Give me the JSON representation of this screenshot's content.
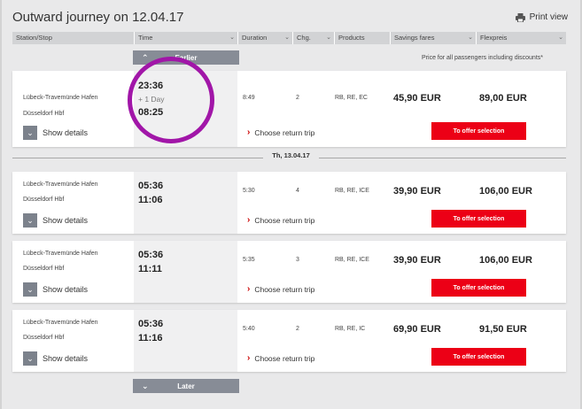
{
  "header": {
    "title": "Outward journey on 12.04.17",
    "print_label": "Print view"
  },
  "columns": [
    {
      "label": "Station/Stop"
    },
    {
      "label": "Time"
    },
    {
      "label": "Duration"
    },
    {
      "label": "Chg."
    },
    {
      "label": "Products"
    },
    {
      "label": "Savings fares"
    },
    {
      "label": "Flexpreis"
    }
  ],
  "earlier_label": "Earlier",
  "later_label": "Later",
  "price_note": "Price for all passengers including discounts*",
  "day_separator": "Th, 13.04.17",
  "connections": [
    {
      "from": "Lübeck-Travemünde Hafen",
      "to": "Düsseldorf Hbf",
      "dep": "23:36",
      "extra": "+ 1 Day",
      "arr": "08:25",
      "duration": "8:49",
      "changes": "2",
      "products": "RB, RE, EC",
      "savings": "45,90 EUR",
      "flex": "89,00 EUR",
      "details_label": "Show details",
      "return_label": "Choose return trip",
      "offer_label": "To offer selection"
    },
    {
      "from": "Lübeck-Travemünde Hafen",
      "to": "Düsseldorf Hbf",
      "dep": "05:36",
      "arr": "11:06",
      "duration": "5:30",
      "changes": "4",
      "products": "RB, RE, ICE",
      "savings": "39,90 EUR",
      "flex": "106,00 EUR",
      "details_label": "Show details",
      "return_label": "Choose return trip",
      "offer_label": "To offer selection"
    },
    {
      "from": "Lübeck-Travemünde Hafen",
      "to": "Düsseldorf Hbf",
      "dep": "05:36",
      "arr": "11:11",
      "duration": "5:35",
      "changes": "3",
      "products": "RB, RE, ICE",
      "savings": "39,90 EUR",
      "flex": "106,00 EUR",
      "details_label": "Show details",
      "return_label": "Choose return trip",
      "offer_label": "To offer selection"
    },
    {
      "from": "Lübeck-Travemünde Hafen",
      "to": "Düsseldorf Hbf",
      "dep": "05:36",
      "arr": "11:16",
      "duration": "5:40",
      "changes": "2",
      "products": "RB, RE, IC",
      "savings": "69,90 EUR",
      "flex": "91,50 EUR",
      "details_label": "Show details",
      "return_label": "Choose return trip",
      "offer_label": "To offer selection"
    }
  ],
  "annotation": {
    "color": "#a116a8"
  },
  "colors": {
    "offer_button": "#ec0016",
    "accent_arrow": "#cc0000"
  }
}
